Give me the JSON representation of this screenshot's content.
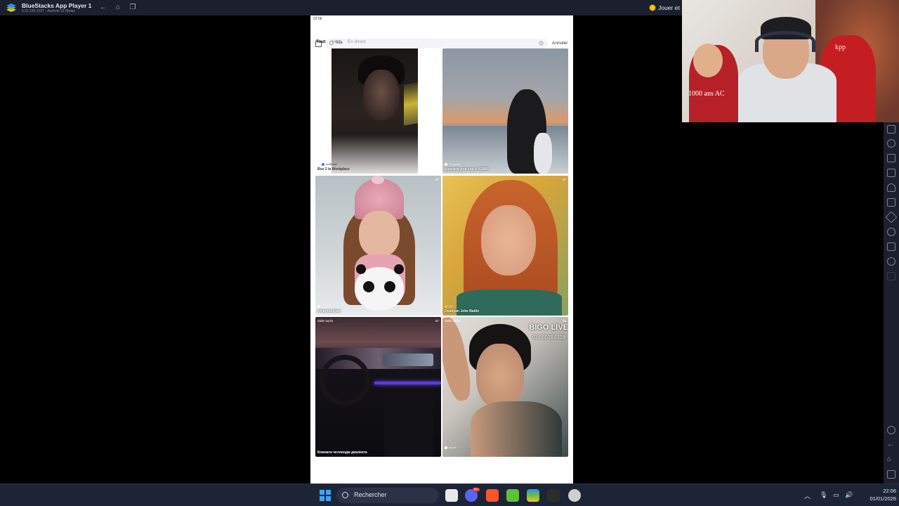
{
  "window": {
    "title": "BlueStacks App Player 1",
    "version": "5.22.150.1027 · Android 13 (Beta)",
    "play_label": "Jouer et"
  },
  "phone": {
    "status_time": "22:06",
    "search_value": "filla",
    "cancel_label": "Annuler",
    "tabs": [
      {
        "label": "Tout",
        "active": true
      },
      {
        "label": "Host",
        "active": false
      },
      {
        "label": "En direct",
        "active": false
      }
    ],
    "cards": [
      {
        "title": "Bos 2 la Workplace",
        "tag": "wolfKhan",
        "count": "",
        "top": ""
      },
      {
        "title": "Комната для сна и ASMR",
        "tag": "Тихушка",
        "count": "",
        "top": ""
      },
      {
        "title": "Alhamdulillah",
        "tag": "Laila Khan",
        "count": "91",
        "top": ""
      },
      {
        "title": "Deadpan Joke Battle",
        "tag": "Lili",
        "count": "67",
        "top": ""
      },
      {
        "title": "Комната челлендж диалекта",
        "tag": "",
        "count": "67",
        "top": "Salle audio"
      },
      {
        "title": "",
        "tag": "studio",
        "count": "46",
        "top": "Salle audio"
      }
    ],
    "bigo_brand": "BIGO LIVE",
    "bigo_id": "ID:665780329"
  },
  "webcam": {
    "overlay_text_1": "1000 ans AC",
    "overlay_text_2": "kpp"
  },
  "taskbar": {
    "search_label": "Rechercher",
    "time": "22:06",
    "date": "01/01/2026",
    "badge": "99+"
  },
  "colors": {
    "bluestacks_bar": "#1c1f2e",
    "taskbar": "#1d2436",
    "windows_blue": "#3fa3f7"
  }
}
